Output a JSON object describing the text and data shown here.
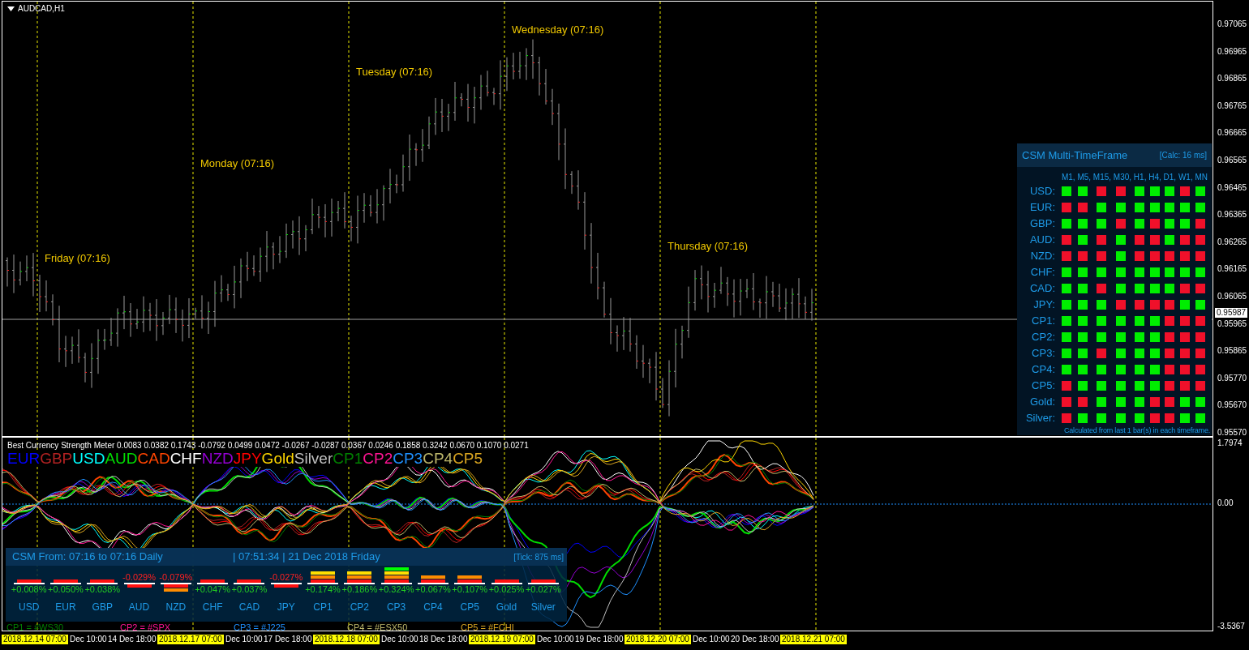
{
  "chart": {
    "title": "AUDCAD,H1",
    "day_labels": [
      "Friday (07:16)",
      "Monday (07:16)",
      "Tuesday (07:16)",
      "Wednesday (07:16)",
      "Thursday (07:16)"
    ]
  },
  "price_axis": {
    "ticks": [
      "0.97065",
      "0.96965",
      "0.96865",
      "0.96765",
      "0.96665",
      "0.96565",
      "0.96465",
      "0.96365",
      "0.96265",
      "0.96165",
      "0.96065",
      "0.95965",
      "0.95865",
      "0.95770",
      "0.95670",
      "0.95570"
    ],
    "current_price": "0.95987"
  },
  "mtf_panel": {
    "title": "CSM Multi-TimeFrame",
    "calc": "[Calc: 16 ms]",
    "timeframes": "M1, M5, M15, M30, H1, H4, D1, W1, MN",
    "rows": [
      {
        "label": "USD:",
        "up": [
          true,
          true,
          false,
          false,
          true,
          true,
          true,
          false,
          true
        ]
      },
      {
        "label": "EUR:",
        "up": [
          false,
          false,
          true,
          true,
          true,
          true,
          true,
          true,
          true
        ]
      },
      {
        "label": "GBP:",
        "up": [
          true,
          true,
          true,
          false,
          true,
          false,
          true,
          true,
          false
        ]
      },
      {
        "label": "AUD:",
        "up": [
          false,
          true,
          false,
          true,
          false,
          false,
          true,
          false,
          false
        ]
      },
      {
        "label": "NZD:",
        "up": [
          false,
          false,
          false,
          true,
          false,
          false,
          false,
          false,
          false
        ]
      },
      {
        "label": "CHF:",
        "up": [
          true,
          true,
          true,
          true,
          true,
          true,
          true,
          true,
          true
        ]
      },
      {
        "label": "CAD:",
        "up": [
          true,
          true,
          false,
          true,
          true,
          true,
          true,
          false,
          false
        ]
      },
      {
        "label": "JPY:",
        "up": [
          true,
          true,
          true,
          false,
          false,
          false,
          false,
          true,
          true
        ]
      },
      {
        "label": "CP1:",
        "up": [
          true,
          true,
          true,
          true,
          true,
          true,
          false,
          false,
          false
        ]
      },
      {
        "label": "CP2:",
        "up": [
          true,
          true,
          true,
          true,
          true,
          true,
          false,
          false,
          false
        ]
      },
      {
        "label": "CP3:",
        "up": [
          true,
          true,
          false,
          true,
          true,
          true,
          false,
          false,
          false
        ]
      },
      {
        "label": "CP4:",
        "up": [
          true,
          true,
          true,
          true,
          true,
          true,
          false,
          false,
          false
        ]
      },
      {
        "label": "CP5:",
        "up": [
          false,
          true,
          true,
          true,
          true,
          true,
          false,
          false,
          false
        ]
      },
      {
        "label": "Gold:",
        "up": [
          false,
          false,
          true,
          true,
          true,
          false,
          false,
          true,
          true
        ]
      },
      {
        "label": "Silver:",
        "up": [
          false,
          true,
          true,
          true,
          true,
          false,
          false,
          true,
          true
        ]
      }
    ],
    "footer": "Calculated from last 1 bar(s) in each timeframe."
  },
  "indicator": {
    "title": "Best Currency Strength Meter 0.0083 0.0382 0.1743 -0.0792 0.0499 0.0472 -0.0267 -0.0287 0.0367 0.0246 0.1858 0.3242 0.0670 0.1070 0.0271",
    "legend": [
      {
        "name": "EUR",
        "color": "#0000ff"
      },
      {
        "name": "GBP",
        "color": "#b22222"
      },
      {
        "name": "USD",
        "color": "#00ffff"
      },
      {
        "name": "AUD",
        "color": "#00dd00"
      },
      {
        "name": "CAD",
        "color": "#ff4500"
      },
      {
        "name": "CHF",
        "color": "#ffffff"
      },
      {
        "name": "NZD",
        "color": "#9400d3"
      },
      {
        "name": "JPY",
        "color": "#ff0000"
      },
      {
        "name": "Gold",
        "color": "#ffd700"
      },
      {
        "name": "Silver",
        "color": "#c0c0c0"
      },
      {
        "name": "CP1",
        "color": "#008000"
      },
      {
        "name": "CP2",
        "color": "#ff1493"
      },
      {
        "name": "CP3",
        "color": "#1e90ff"
      },
      {
        "name": "CP4",
        "color": "#bdb76b"
      },
      {
        "name": "CP5",
        "color": "#daa520"
      }
    ],
    "axis": [
      "1.7974",
      "0.00",
      "-3.5367"
    ]
  },
  "csm_panel": {
    "range": "CSM From: 07:16 to 07:16 Daily",
    "clock": "| 07:51:34 | 21 Dec 2018 Friday",
    "tick": "[Tick: 875 ms]",
    "items": [
      {
        "name": "USD",
        "change": "+0.008%",
        "positive": true,
        "bars": [
          {
            "color": "#ff1010"
          }
        ]
      },
      {
        "name": "EUR",
        "change": "+0.050%",
        "positive": true,
        "bars": [
          {
            "color": "#ff1010"
          }
        ]
      },
      {
        "name": "GBP",
        "change": "+0.038%",
        "positive": true,
        "bars": [
          {
            "color": "#ff1010"
          }
        ]
      },
      {
        "name": "AUD",
        "change": "-0.029%",
        "positive": false,
        "bars": [
          {
            "color": "#ff1010"
          }
        ]
      },
      {
        "name": "NZD",
        "change": "-0.079%",
        "positive": false,
        "bars": [
          {
            "color": "#ff1010"
          },
          {
            "color": "#ff8c00"
          }
        ]
      },
      {
        "name": "CHF",
        "change": "+0.047%",
        "positive": true,
        "bars": [
          {
            "color": "#ff1010"
          }
        ]
      },
      {
        "name": "CAD",
        "change": "+0.037%",
        "positive": true,
        "bars": [
          {
            "color": "#ff1010"
          }
        ]
      },
      {
        "name": "JPY",
        "change": "-0.027%",
        "positive": false,
        "bars": [
          {
            "color": "#ff1010"
          }
        ]
      },
      {
        "name": "CP1",
        "change": "+0.174%",
        "positive": true,
        "bars": [
          {
            "color": "#ff1010"
          },
          {
            "color": "#ff8c00"
          },
          {
            "color": "#ffe000"
          }
        ]
      },
      {
        "name": "CP2",
        "change": "+0.186%",
        "positive": true,
        "bars": [
          {
            "color": "#ff1010"
          },
          {
            "color": "#ff8c00"
          },
          {
            "color": "#ffe000"
          }
        ]
      },
      {
        "name": "CP3",
        "change": "+0.324%",
        "positive": true,
        "bars": [
          {
            "color": "#ff1010"
          },
          {
            "color": "#ff8c00"
          },
          {
            "color": "#ffe000"
          },
          {
            "color": "#00ff00"
          }
        ]
      },
      {
        "name": "CP4",
        "change": "+0.067%",
        "positive": true,
        "bars": [
          {
            "color": "#ff1010"
          },
          {
            "color": "#ff8c00"
          }
        ]
      },
      {
        "name": "CP5",
        "change": "+0.107%",
        "positive": true,
        "bars": [
          {
            "color": "#ff1010"
          },
          {
            "color": "#ff8c00"
          }
        ]
      },
      {
        "name": "Gold",
        "change": "+0.025%",
        "positive": true,
        "bars": [
          {
            "color": "#ff1010"
          }
        ]
      },
      {
        "name": "Silver",
        "change": "+0.027%",
        "positive": true,
        "bars": [
          {
            "color": "#ff1010"
          }
        ]
      }
    ],
    "symbols": [
      {
        "text": "CP1 = #WS30",
        "color": "#008000"
      },
      {
        "text": "CP2 = #SPX",
        "color": "#ff1493"
      },
      {
        "text": "CP3 = #J225",
        "color": "#1e90ff"
      },
      {
        "text": "CP4 = #ESX50",
        "color": "#bdb76b"
      },
      {
        "text": "CP5 = #FCHI",
        "color": "#daa520"
      }
    ]
  },
  "time_axis": [
    {
      "text": "2018.12.14 07:00",
      "highlighted": true
    },
    {
      "text": "Dec 10:00",
      "highlighted": false
    },
    {
      "text": "14 Dec 18:00",
      "highlighted": false
    },
    {
      "text": "2018.12.17 07:00",
      "highlighted": true
    },
    {
      "text": "Dec 10:00",
      "highlighted": false
    },
    {
      "text": "17 Dec 18:00",
      "highlighted": false
    },
    {
      "text": "2018.12.18 07:00",
      "highlighted": true
    },
    {
      "text": "Dec 10:00",
      "highlighted": false
    },
    {
      "text": "18 Dec 18:00",
      "highlighted": false
    },
    {
      "text": "2018.12.19 07:00",
      "highlighted": true
    },
    {
      "text": "Dec 10:00",
      "highlighted": false
    },
    {
      "text": "19 Dec 18:00",
      "highlighted": false
    },
    {
      "text": "2018.12.20 07:00",
      "highlighted": true
    },
    {
      "text": "Dec 10:00",
      "highlighted": false
    },
    {
      "text": "20 Dec 18:00",
      "highlighted": false
    },
    {
      "text": "2018.12.21 07:00",
      "highlighted": true
    }
  ]
}
